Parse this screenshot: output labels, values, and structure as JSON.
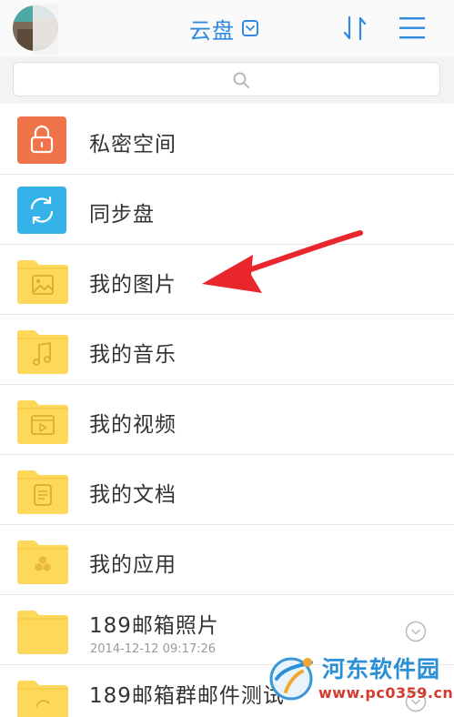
{
  "header": {
    "title": "云盘",
    "title_dropdown_icon": "chevron-down-icon",
    "sort_icon": "sort-icon",
    "menu_icon": "hamburger-menu-icon"
  },
  "search": {
    "icon": "search-icon",
    "placeholder": ""
  },
  "items": [
    {
      "label": "私密空间",
      "icon": "lock-icon",
      "tile_color": "#f0734a"
    },
    {
      "label": "同步盘",
      "icon": "sync-icon",
      "tile_color": "#35b3e9"
    },
    {
      "label": "我的图片",
      "icon": "folder-image-icon",
      "tile_color": "#fdd85a"
    },
    {
      "label": "我的音乐",
      "icon": "folder-music-icon",
      "tile_color": "#fdd85a"
    },
    {
      "label": "我的视频",
      "icon": "folder-video-icon",
      "tile_color": "#fdd85a"
    },
    {
      "label": "我的文档",
      "icon": "folder-document-icon",
      "tile_color": "#fdd85a"
    },
    {
      "label": "我的应用",
      "icon": "folder-apps-icon",
      "tile_color": "#fdd85a"
    },
    {
      "label": "189邮箱照片",
      "date": "2014-12-12 09:17:26",
      "icon": "folder-icon",
      "tile_color": "#fdd85a"
    },
    {
      "label": "189邮箱群邮件测试",
      "icon": "folder-icon",
      "tile_color": "#fdd85a"
    }
  ],
  "annotation": {
    "arrow_color": "#e8262c"
  },
  "watermark": {
    "title": "河东软件园",
    "url": "www.pc0359.cn"
  }
}
